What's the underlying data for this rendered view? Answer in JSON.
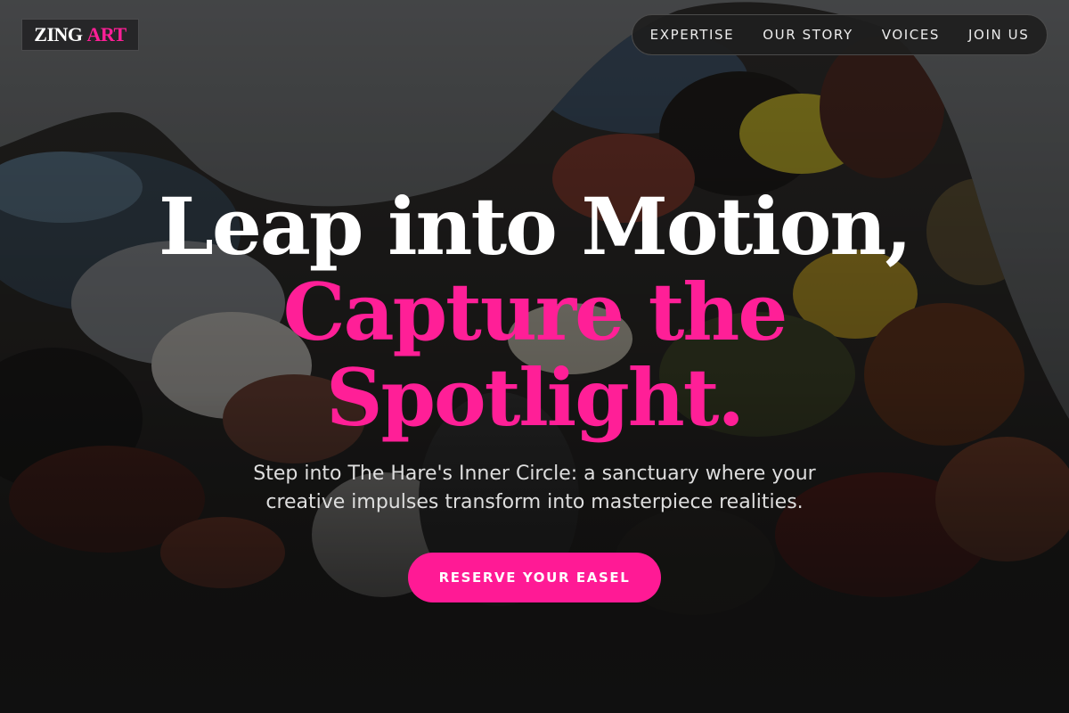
{
  "logo": {
    "word1": "ZING",
    "word2": "ART"
  },
  "nav": {
    "items": [
      {
        "label": "EXPERTISE"
      },
      {
        "label": "OUR STORY"
      },
      {
        "label": "VOICES"
      },
      {
        "label": "JOIN US"
      }
    ]
  },
  "hero": {
    "headline_line1": "Leap into Motion,",
    "headline_line2": "Capture the",
    "headline_line3": "Spotlight.",
    "subtitle": "Step into The Hare's Inner Circle: a sanctuary where your creative impulses transform into masterpiece realities.",
    "cta_label": "RESERVE YOUR EASEL"
  },
  "colors": {
    "accent": "#ff1f97",
    "background": "#242424",
    "text": "#ffffff"
  }
}
